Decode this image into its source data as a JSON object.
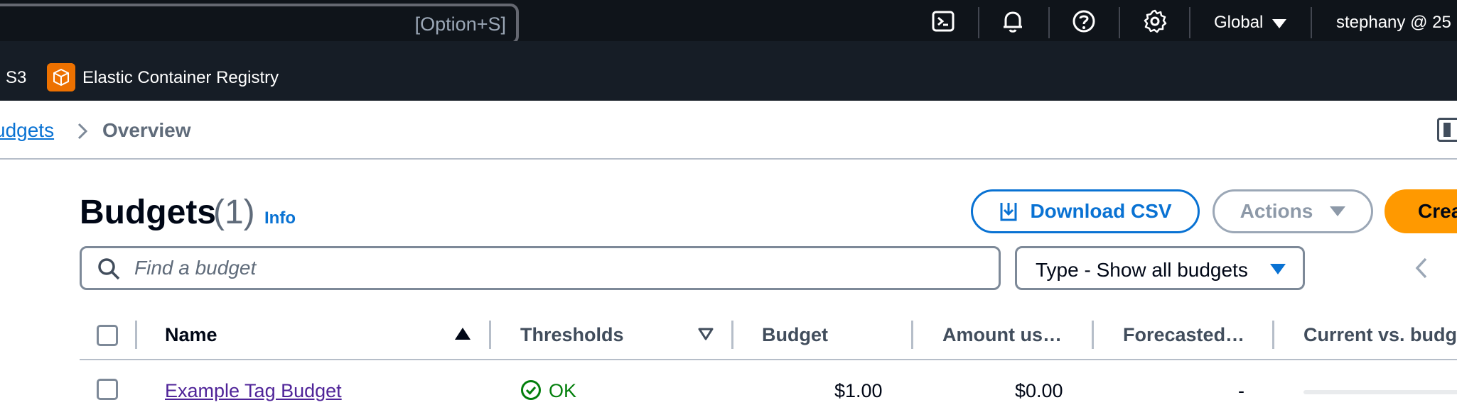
{
  "topnav": {
    "search_shortcut": "[Option+S]",
    "icons": [
      "cloudshell-icon",
      "bell-icon",
      "help-icon",
      "gear-icon"
    ],
    "region": "Global",
    "account": "stephany @ 25"
  },
  "favorites": {
    "items": [
      {
        "label": "S3"
      },
      {
        "label": "Elastic Container Registry",
        "icon": "ecr-icon"
      }
    ]
  },
  "breadcrumb": {
    "items": [
      "udgets",
      "Overview"
    ]
  },
  "header": {
    "title": "Budgets",
    "count": "(1)",
    "info": "Info",
    "download_label": "Download CSV",
    "actions_label": "Actions",
    "create_label": "Crea"
  },
  "filters": {
    "search_placeholder": "Find a budget",
    "type_label": "Type - Show all budgets"
  },
  "table": {
    "columns": [
      "Name",
      "Thresholds",
      "Budget",
      "Amount us…",
      "Forecasted…",
      "Current vs. budg"
    ],
    "rows": [
      {
        "name": "Example Tag Budget",
        "threshold_status": "OK",
        "budget": "$1.00",
        "amount_used": "$0.00",
        "forecasted": "-",
        "current_vs_budget_fraction": 0
      }
    ]
  },
  "colors": {
    "link": "#0972d3",
    "ok": "#037f0c",
    "primary": "#ff9900",
    "topnav_bg": "#0f141a",
    "favbar_bg": "#161d26"
  }
}
